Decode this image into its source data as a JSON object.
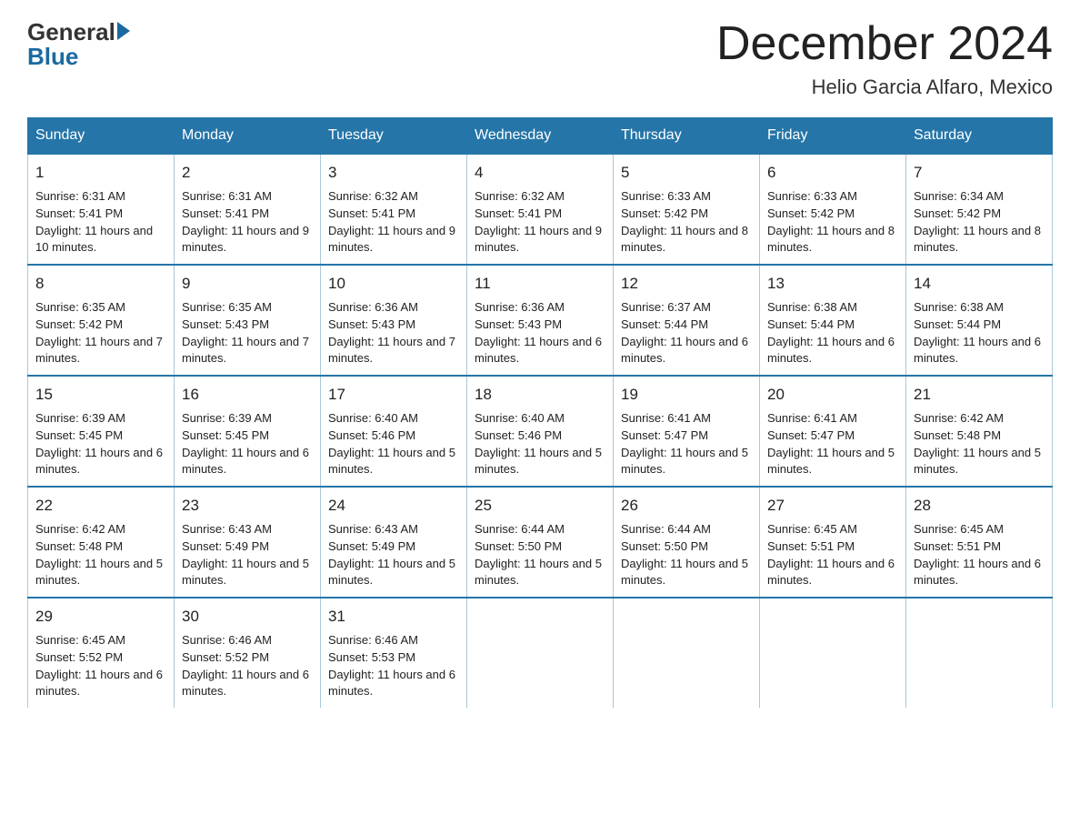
{
  "logo": {
    "general": "General",
    "blue": "Blue"
  },
  "title": "December 2024",
  "subtitle": "Helio Garcia Alfaro, Mexico",
  "days": [
    "Sunday",
    "Monday",
    "Tuesday",
    "Wednesday",
    "Thursday",
    "Friday",
    "Saturday"
  ],
  "weeks": [
    [
      {
        "num": "1",
        "sunrise": "6:31 AM",
        "sunset": "5:41 PM",
        "daylight": "11 hours and 10 minutes."
      },
      {
        "num": "2",
        "sunrise": "6:31 AM",
        "sunset": "5:41 PM",
        "daylight": "11 hours and 9 minutes."
      },
      {
        "num": "3",
        "sunrise": "6:32 AM",
        "sunset": "5:41 PM",
        "daylight": "11 hours and 9 minutes."
      },
      {
        "num": "4",
        "sunrise": "6:32 AM",
        "sunset": "5:41 PM",
        "daylight": "11 hours and 9 minutes."
      },
      {
        "num": "5",
        "sunrise": "6:33 AM",
        "sunset": "5:42 PM",
        "daylight": "11 hours and 8 minutes."
      },
      {
        "num": "6",
        "sunrise": "6:33 AM",
        "sunset": "5:42 PM",
        "daylight": "11 hours and 8 minutes."
      },
      {
        "num": "7",
        "sunrise": "6:34 AM",
        "sunset": "5:42 PM",
        "daylight": "11 hours and 8 minutes."
      }
    ],
    [
      {
        "num": "8",
        "sunrise": "6:35 AM",
        "sunset": "5:42 PM",
        "daylight": "11 hours and 7 minutes."
      },
      {
        "num": "9",
        "sunrise": "6:35 AM",
        "sunset": "5:43 PM",
        "daylight": "11 hours and 7 minutes."
      },
      {
        "num": "10",
        "sunrise": "6:36 AM",
        "sunset": "5:43 PM",
        "daylight": "11 hours and 7 minutes."
      },
      {
        "num": "11",
        "sunrise": "6:36 AM",
        "sunset": "5:43 PM",
        "daylight": "11 hours and 6 minutes."
      },
      {
        "num": "12",
        "sunrise": "6:37 AM",
        "sunset": "5:44 PM",
        "daylight": "11 hours and 6 minutes."
      },
      {
        "num": "13",
        "sunrise": "6:38 AM",
        "sunset": "5:44 PM",
        "daylight": "11 hours and 6 minutes."
      },
      {
        "num": "14",
        "sunrise": "6:38 AM",
        "sunset": "5:44 PM",
        "daylight": "11 hours and 6 minutes."
      }
    ],
    [
      {
        "num": "15",
        "sunrise": "6:39 AM",
        "sunset": "5:45 PM",
        "daylight": "11 hours and 6 minutes."
      },
      {
        "num": "16",
        "sunrise": "6:39 AM",
        "sunset": "5:45 PM",
        "daylight": "11 hours and 6 minutes."
      },
      {
        "num": "17",
        "sunrise": "6:40 AM",
        "sunset": "5:46 PM",
        "daylight": "11 hours and 5 minutes."
      },
      {
        "num": "18",
        "sunrise": "6:40 AM",
        "sunset": "5:46 PM",
        "daylight": "11 hours and 5 minutes."
      },
      {
        "num": "19",
        "sunrise": "6:41 AM",
        "sunset": "5:47 PM",
        "daylight": "11 hours and 5 minutes."
      },
      {
        "num": "20",
        "sunrise": "6:41 AM",
        "sunset": "5:47 PM",
        "daylight": "11 hours and 5 minutes."
      },
      {
        "num": "21",
        "sunrise": "6:42 AM",
        "sunset": "5:48 PM",
        "daylight": "11 hours and 5 minutes."
      }
    ],
    [
      {
        "num": "22",
        "sunrise": "6:42 AM",
        "sunset": "5:48 PM",
        "daylight": "11 hours and 5 minutes."
      },
      {
        "num": "23",
        "sunrise": "6:43 AM",
        "sunset": "5:49 PM",
        "daylight": "11 hours and 5 minutes."
      },
      {
        "num": "24",
        "sunrise": "6:43 AM",
        "sunset": "5:49 PM",
        "daylight": "11 hours and 5 minutes."
      },
      {
        "num": "25",
        "sunrise": "6:44 AM",
        "sunset": "5:50 PM",
        "daylight": "11 hours and 5 minutes."
      },
      {
        "num": "26",
        "sunrise": "6:44 AM",
        "sunset": "5:50 PM",
        "daylight": "11 hours and 5 minutes."
      },
      {
        "num": "27",
        "sunrise": "6:45 AM",
        "sunset": "5:51 PM",
        "daylight": "11 hours and 6 minutes."
      },
      {
        "num": "28",
        "sunrise": "6:45 AM",
        "sunset": "5:51 PM",
        "daylight": "11 hours and 6 minutes."
      }
    ],
    [
      {
        "num": "29",
        "sunrise": "6:45 AM",
        "sunset": "5:52 PM",
        "daylight": "11 hours and 6 minutes."
      },
      {
        "num": "30",
        "sunrise": "6:46 AM",
        "sunset": "5:52 PM",
        "daylight": "11 hours and 6 minutes."
      },
      {
        "num": "31",
        "sunrise": "6:46 AM",
        "sunset": "5:53 PM",
        "daylight": "11 hours and 6 minutes."
      },
      null,
      null,
      null,
      null
    ]
  ]
}
